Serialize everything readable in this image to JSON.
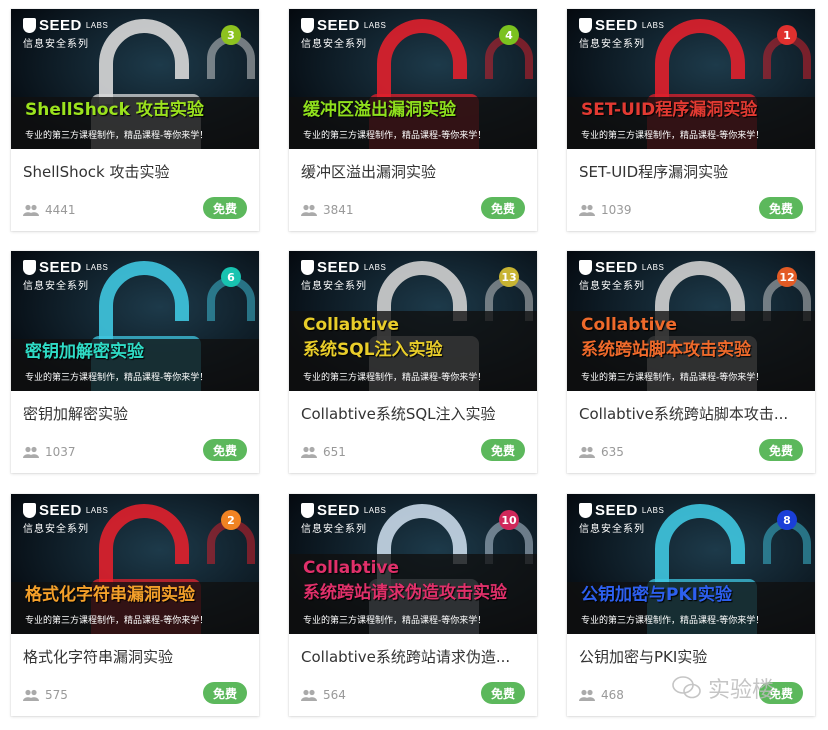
{
  "cards": [
    {
      "brand": "SEED",
      "labs": "LABS",
      "sub": "信息安全系列",
      "badge": "3",
      "badge_color": "#8dc21f",
      "title1": "ShellShock 攻击实验",
      "title2": "",
      "title_color": "#9be21e",
      "tagline": "专业的第三方课程制作，精品课程-等你来学！",
      "name": "ShellShock 攻击实验",
      "users": "4441",
      "price": "免费",
      "lock": "#d8d8d8"
    },
    {
      "brand": "SEED",
      "labs": "LABS",
      "sub": "信息安全系列",
      "badge": "4",
      "badge_color": "#7bc21f",
      "title1": "缓冲区溢出漏洞实验",
      "title2": "",
      "title_color": "#8fe01d",
      "tagline": "专业的第三方课程制作，精品课程-等你来学！",
      "name": "缓冲区溢出漏洞实验",
      "users": "3841",
      "price": "免费",
      "lock": "#e0202c"
    },
    {
      "brand": "SEED",
      "labs": "LABS",
      "sub": "信息安全系列",
      "badge": "1",
      "badge_color": "#e0302e",
      "title1": "SET-UID程序漏洞实验",
      "title2": "",
      "title_color": "#e23a32",
      "tagline": "专业的第三方课程制作，精品课程-等你来学！",
      "name": "SET-UID程序漏洞实验",
      "users": "1039",
      "price": "免费",
      "lock": "#e0202c"
    },
    {
      "brand": "SEED",
      "labs": "LABS",
      "sub": "信息安全系列",
      "badge": "6",
      "badge_color": "#18c3b0",
      "title1": "密钥加解密实验",
      "title2": "",
      "title_color": "#2fdcc6",
      "tagline": "专业的第三方课程制作，精品课程-等你来学！",
      "name": "密钥加解密实验",
      "users": "1037",
      "price": "免费",
      "lock": "#3fc6e0"
    },
    {
      "brand": "SEED",
      "labs": "LABS",
      "sub": "信息安全系列",
      "badge": "13",
      "badge_color": "#c8b432",
      "title1": "Collabtive",
      "title2": "系统SQL注入实验",
      "title_color": "#e8cd2a",
      "tagline": "专业的第三方课程制作，精品课程-等你来学！",
      "name": "Collabtive系统SQL注入实验",
      "users": "651",
      "price": "免费",
      "lock": "#d0d0d0"
    },
    {
      "brand": "SEED",
      "labs": "LABS",
      "sub": "信息安全系列",
      "badge": "12",
      "badge_color": "#e35b25",
      "title1": "Collabtive",
      "title2": "系统跨站脚本攻击实验",
      "title_color": "#ef6a2b",
      "tagline": "专业的第三方课程制作，精品课程-等你来学！",
      "name": "Collabtive系统跨站脚本攻击...",
      "users": "635",
      "price": "免费",
      "lock": "#d0d0d0"
    },
    {
      "brand": "SEED",
      "labs": "LABS",
      "sub": "信息安全系列",
      "badge": "2",
      "badge_color": "#f08323",
      "title1": "格式化字符串漏洞实验",
      "title2": "",
      "title_color": "#f4a02a",
      "tagline": "专业的第三方课程制作，精品课程-等你来学！",
      "name": "格式化字符串漏洞实验",
      "users": "575",
      "price": "免费",
      "lock": "#e0202c"
    },
    {
      "brand": "SEED",
      "labs": "LABS",
      "sub": "信息安全系列",
      "badge": "10",
      "badge_color": "#d0285a",
      "title1": "Collabtive",
      "title2": "系统跨站请求伪造攻击实验",
      "title_color": "#e0306a",
      "tagline": "专业的第三方课程制作，精品课程-等你来学！",
      "name": "Collabtive系统跨站请求伪造...",
      "users": "564",
      "price": "免费",
      "lock": "#c8d8e8"
    },
    {
      "brand": "SEED",
      "labs": "LABS",
      "sub": "信息安全系列",
      "badge": "8",
      "badge_color": "#1a3fd8",
      "title1": "公钥加密与PKI实验",
      "title2": "",
      "title_color": "#2d60f0",
      "tagline": "专业的第三方课程制作，精品课程-等你来学！",
      "name": "公钥加密与PKI实验",
      "users": "468",
      "price": "免费",
      "lock": "#3fc6e0"
    }
  ],
  "watermark": "实验楼"
}
